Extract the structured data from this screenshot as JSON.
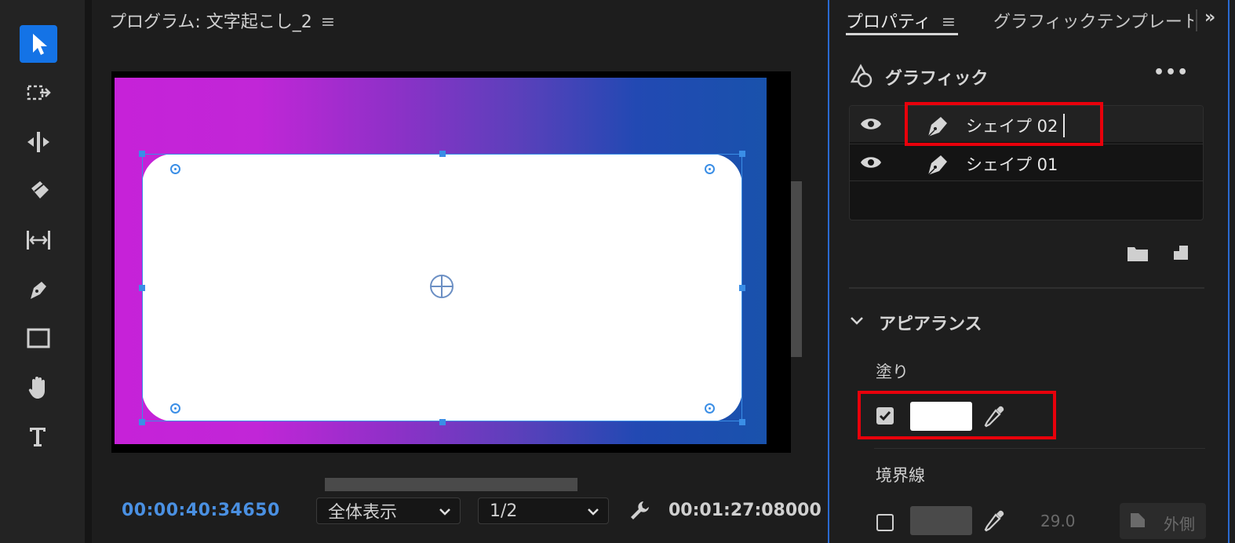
{
  "toolbar": {
    "tools": [
      {
        "name": "selection-tool",
        "icon": "arrow-icon",
        "active": true
      },
      {
        "name": "track-select-tool",
        "icon": "track-select-icon"
      },
      {
        "name": "ripple-edit-tool",
        "icon": "ripple-edit-icon"
      },
      {
        "name": "razor-tool",
        "icon": "razor-icon"
      },
      {
        "name": "slip-tool",
        "icon": "slip-icon"
      },
      {
        "name": "pen-tool",
        "icon": "pen-icon"
      },
      {
        "name": "rectangle-tool",
        "icon": "rectangle-icon"
      },
      {
        "name": "hand-tool",
        "icon": "hand-icon"
      },
      {
        "name": "type-tool",
        "icon": "type-icon"
      }
    ],
    "accent": "#1473e6"
  },
  "monitor": {
    "title": "プログラム: 文字起こし_2",
    "menu_glyph": "≡",
    "timecode": "00:00:40:34650",
    "zoom": "全体表示",
    "resolution": "1/2",
    "duration": "00:01:27:08000",
    "gradient_colors": [
      "#c622d8",
      "#1952ac"
    ]
  },
  "properties": {
    "tab_active": "プロパティ",
    "tab_menu": "≡",
    "tab_other": "グラフィックテンプレート",
    "more_tabs": "»",
    "graphic_title": "グラフィック",
    "graphic_more": "•••",
    "layers": [
      {
        "name": "シェイプ 02",
        "selected": true
      },
      {
        "name": "シェイプ 01",
        "selected": false
      }
    ],
    "appearance_title": "アピアランス",
    "fill_label": "塗り",
    "fill_enabled": true,
    "fill_color": "#ffffff",
    "stroke_label": "境界線",
    "stroke_enabled": false,
    "stroke_width": "29.0",
    "stroke_position": "外側",
    "highlight_color": "#e8000b"
  }
}
